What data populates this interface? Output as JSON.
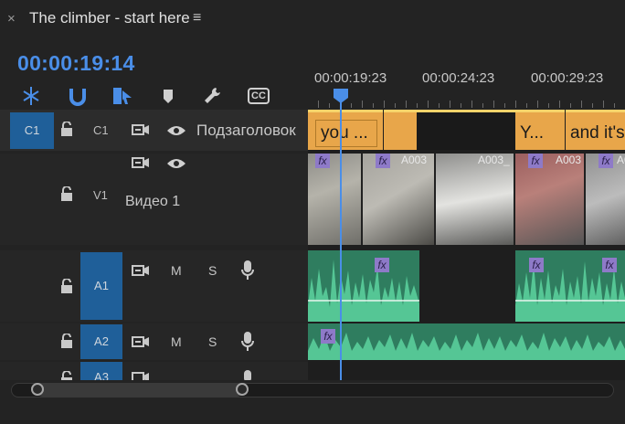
{
  "header": {
    "close_glyph": "×",
    "title": "The climber - start here",
    "menu_glyph": "≡"
  },
  "timecode": "00:00:19:14",
  "toolbar": [
    {
      "name": "snap-in-timeline-icon"
    },
    {
      "name": "linked-selection-icon"
    },
    {
      "name": "insert-overwrite-icon"
    },
    {
      "name": "add-marker-icon"
    },
    {
      "name": "wrench-settings-icon"
    },
    {
      "name": "captions-icon",
      "label": "CC"
    }
  ],
  "ruler": {
    "labels": [
      "00:00:19:23",
      "00:00:24:23",
      "00:00:29:23"
    ]
  },
  "tracks": {
    "c1": {
      "target": "C1",
      "name": "C1",
      "label": "Подзаголовок"
    },
    "v1": {
      "name": "V1",
      "label": "Видео 1"
    },
    "a1": {
      "name": "A1",
      "mute": "M",
      "solo": "S"
    },
    "a2": {
      "name": "A2",
      "mute": "M",
      "solo": "S"
    },
    "a3": {
      "name": "A3"
    }
  },
  "captions": [
    "you ...",
    "Y...",
    "and it's"
  ],
  "video_clips": [
    "A003",
    "A003_",
    "A003",
    "A0"
  ],
  "fx_label": "fx",
  "colors": {
    "accent_blue": "#4a8ee8",
    "caption": "#e8a64a",
    "audio": "#48b98a",
    "target_blue": "#1f5f99",
    "fx": "#8e7ac8"
  }
}
